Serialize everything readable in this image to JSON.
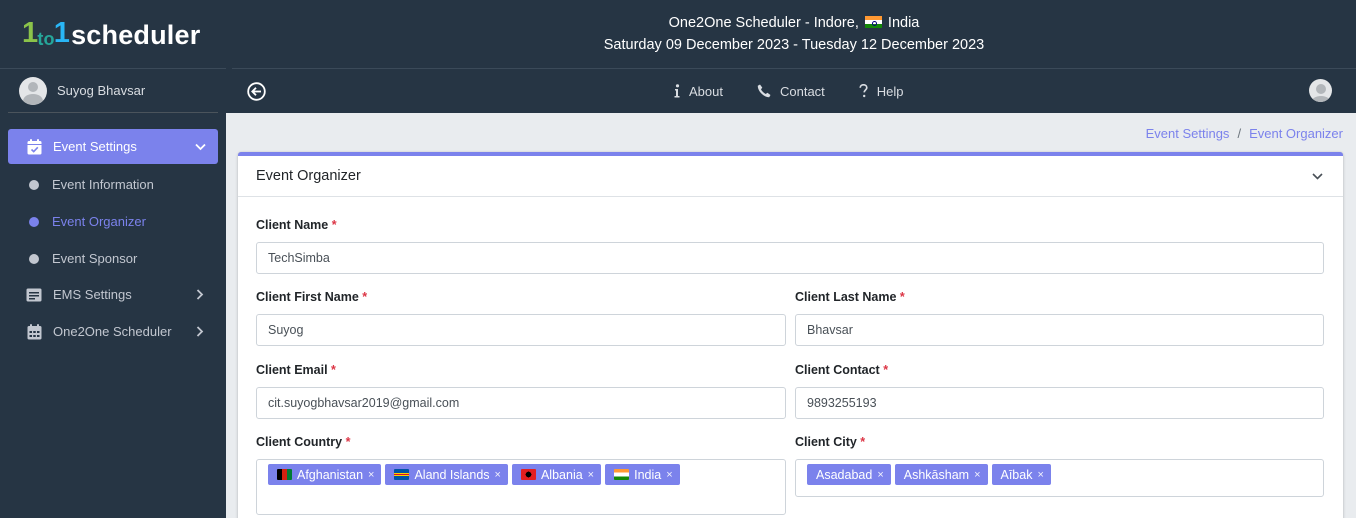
{
  "brand": {
    "logo_mark": [
      "1",
      "to",
      "1"
    ],
    "logo_text": "scheduler"
  },
  "user": {
    "name": "Suyog Bhavsar"
  },
  "sidebar": {
    "items": [
      {
        "label": "Event Settings",
        "icon": "calendar-check-icon",
        "active": true,
        "chevron": "chevron-down-icon"
      },
      {
        "label": "EMS Settings",
        "icon": "id-card-icon",
        "active": false,
        "chevron": "chevron-right-icon"
      },
      {
        "label": "One2One Scheduler",
        "icon": "calendar-grid-icon",
        "active": false,
        "chevron": "chevron-right-icon"
      }
    ],
    "sub_items": [
      {
        "label": "Event Information",
        "current": false
      },
      {
        "label": "Event Organizer",
        "current": true
      },
      {
        "label": "Event Sponsor",
        "current": false
      }
    ]
  },
  "header": {
    "title_prefix": "One2One Scheduler - Indore, ",
    "title_suffix": " India",
    "dates": "Saturday 09 December 2023 - Tuesday 12 December 2023",
    "links": [
      {
        "label": "About",
        "icon": "info-icon"
      },
      {
        "label": "Contact",
        "icon": "phone-icon"
      },
      {
        "label": "Help",
        "icon": "question-icon"
      }
    ]
  },
  "breadcrumb": {
    "items": [
      "Event Settings",
      "Event Organizer"
    ],
    "separator": "/"
  },
  "card": {
    "title": "Event Organizer",
    "fields": {
      "client_name": {
        "label": "Client Name",
        "value": "TechSimba"
      },
      "first_name": {
        "label": "Client First Name",
        "value": "Suyog"
      },
      "last_name": {
        "label": "Client Last Name",
        "value": "Bhavsar"
      },
      "email": {
        "label": "Client Email",
        "value": "cit.suyogbhavsar2019@gmail.com"
      },
      "contact": {
        "label": "Client Contact",
        "value": "9893255193"
      },
      "country": {
        "label": "Client Country",
        "tags": [
          "Afghanistan",
          "Aland Islands",
          "Albania",
          "India"
        ]
      },
      "city": {
        "label": "Client City",
        "tags": [
          "Asadabad",
          "Ashkāsham",
          "Aībak"
        ]
      }
    },
    "required_marker": "*",
    "tag_remove": "×"
  },
  "colors": {
    "sidebar_bg": "#263544",
    "accent": "#7b82ec",
    "content_bg": "#e9ecef",
    "required": "#dc3545"
  }
}
